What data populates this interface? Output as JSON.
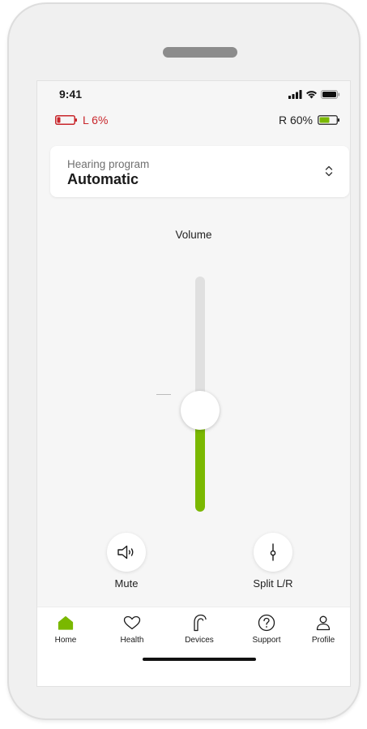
{
  "status_bar": {
    "time": "9:41",
    "icons": [
      "cellular-signal-icon",
      "wifi-icon",
      "battery-icon"
    ]
  },
  "hearing_aid_battery": {
    "left": {
      "label": "L 6%",
      "level": 0.06,
      "color": "#c8262b"
    },
    "right": {
      "label": "R 60%",
      "level": 0.6,
      "color": "#7ab800"
    }
  },
  "program": {
    "caption": "Hearing program",
    "value": "Automatic",
    "icon": "chevron-up-down-icon"
  },
  "volume": {
    "label": "Volume",
    "level": 0.43,
    "accent": "#7ab800"
  },
  "actions": {
    "mute_label": "Mute",
    "mute_icon": "speaker-icon",
    "split_label": "Split L/R",
    "split_icon": "split-slider-icon"
  },
  "tabs": [
    {
      "label": "Home",
      "icon": "home-icon",
      "active": true
    },
    {
      "label": "Health",
      "icon": "heart-icon",
      "active": false
    },
    {
      "label": "Devices",
      "icon": "hearing-aid-icon",
      "active": false
    },
    {
      "label": "Support",
      "icon": "help-icon",
      "active": false
    },
    {
      "label": "Profile",
      "icon": "person-icon",
      "active": false
    }
  ]
}
